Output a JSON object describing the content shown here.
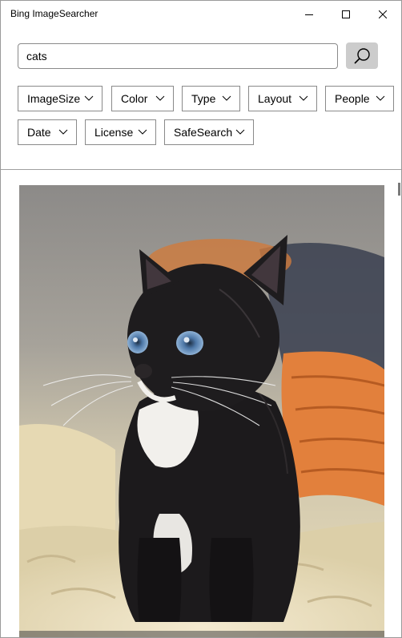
{
  "window": {
    "title": "Bing ImageSearcher",
    "controls": {
      "minimize": "minimize-icon",
      "maximize": "maximize-icon",
      "close": "close-icon"
    }
  },
  "search": {
    "query": "cats",
    "button_icon": "search-icon"
  },
  "filters": [
    {
      "label": "ImageSize"
    },
    {
      "label": "Color"
    },
    {
      "label": "Type"
    },
    {
      "label": "Layout"
    },
    {
      "label": "People"
    },
    {
      "label": "Date"
    },
    {
      "label": "License"
    },
    {
      "label": "SafeSearch"
    }
  ],
  "result": {
    "image_subject": "black-and-white kitten",
    "caption_visible": "partially cut off"
  },
  "colors": {
    "search_button_bg": "#cccccc",
    "border": "#8a8a8a",
    "kitten_fur": "#1c1a1c",
    "basket": "#e07a38",
    "blanket": "#efe3c0"
  }
}
